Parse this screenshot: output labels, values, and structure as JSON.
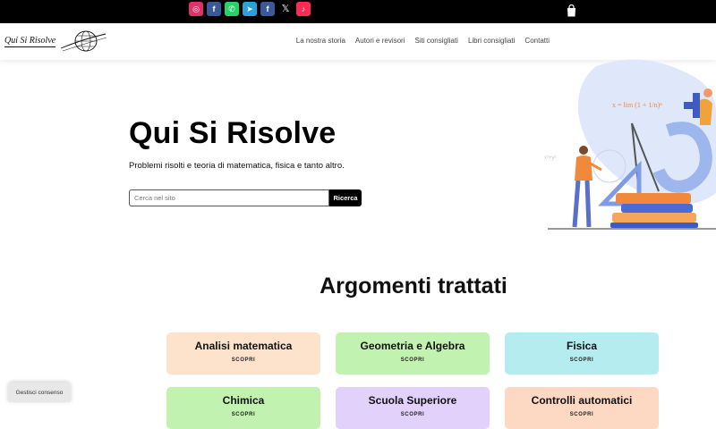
{
  "social": [
    {
      "name": "instagram-icon",
      "glyph": "◎",
      "cls": "ig"
    },
    {
      "name": "facebook-icon",
      "glyph": "f",
      "cls": "fb"
    },
    {
      "name": "whatsapp-icon",
      "glyph": "✆",
      "cls": "wa"
    },
    {
      "name": "telegram-icon",
      "glyph": "➤",
      "cls": "tg"
    },
    {
      "name": "facebook-icon",
      "glyph": "f",
      "cls": "fb"
    },
    {
      "name": "x-icon",
      "glyph": "𝕏",
      "cls": "x"
    },
    {
      "name": "tiktok-icon",
      "glyph": "♪",
      "cls": "tt"
    }
  ],
  "header": {
    "logo_text": "Qui Si Risolve",
    "nav": [
      "La nostra storia",
      "Autori e revisori",
      "Siti consigliati",
      "Libri consigliati",
      "Contatti"
    ]
  },
  "hero": {
    "title": "Qui Si Risolve",
    "subtitle": "Problemi risolti e teoria di matematica, fisica e tanto altro.",
    "search_placeholder": "Cerca nel sito",
    "search_button": "Ricerca"
  },
  "topics": {
    "title": "Argomenti trattati",
    "cta": "SCOPRI",
    "cards": [
      {
        "label": "Analisi matematica",
        "color": "#fde2cc"
      },
      {
        "label": "Geometria e Algebra",
        "color": "#c2f2b0"
      },
      {
        "label": "Fisica",
        "color": "#b4ecef"
      },
      {
        "label": "Chimica",
        "color": "#c2f2b0"
      },
      {
        "label": "Scuola Superiore",
        "color": "#e2d2fb"
      },
      {
        "label": "Controlli automatici",
        "color": "#fdd8c2"
      }
    ]
  },
  "consent": {
    "label": "Gestisci consenso"
  }
}
